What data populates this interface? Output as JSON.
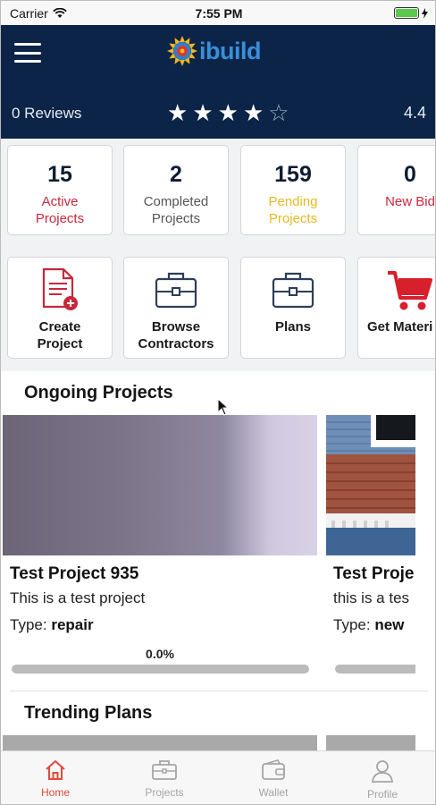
{
  "status_bar": {
    "carrier": "Carrier",
    "time": "7:55 PM"
  },
  "header": {
    "logo_text": "ibuild",
    "reviews": "0 Reviews",
    "stars": [
      "★",
      "★",
      "★",
      "★",
      "☆"
    ],
    "rating_value": 4,
    "rating": "4.4"
  },
  "stats": [
    {
      "value": "15",
      "label_line1": "Active",
      "label_line2": "Projects",
      "color": "#c8283a"
    },
    {
      "value": "2",
      "label_line1": "Completed",
      "label_line2": "Projects",
      "color": "#555555"
    },
    {
      "value": "159",
      "label_line1": "Pending",
      "label_line2": "Projects",
      "color": "#e9b824"
    },
    {
      "value": "0",
      "label_line1": "New Bid",
      "label_line2": "",
      "color": "#c8283a"
    }
  ],
  "actions": [
    {
      "icon": "create-document-icon",
      "label_line1": "Create",
      "label_line2": "Project"
    },
    {
      "icon": "briefcase-icon",
      "label_line1": "Browse",
      "label_line2": "Contractors"
    },
    {
      "icon": "briefcase-icon",
      "label_line1": "Plans",
      "label_line2": ""
    },
    {
      "icon": "cart-icon",
      "label_line1": "Get Materi",
      "label_line2": ""
    }
  ],
  "ongoing": {
    "title": "Ongoing Projects",
    "projects": [
      {
        "title": "Test Project 935",
        "description": "This is a test project",
        "type_label": "Type:",
        "type_value": "repair",
        "progress": "0.0%",
        "progress_value": 0
      },
      {
        "title": "Test Proje",
        "description": "this is a tes",
        "type_label": "Type:",
        "type_value": "new"
      }
    ]
  },
  "trending": {
    "title": "Trending Plans"
  },
  "tabbar": {
    "tabs": [
      {
        "label": "Home",
        "icon": "home-icon",
        "active": true
      },
      {
        "label": "Projects",
        "icon": "projects-icon",
        "active": false
      },
      {
        "label": "Wallet",
        "icon": "wallet-icon",
        "active": false
      },
      {
        "label": "Profile",
        "icon": "profile-icon",
        "active": false
      }
    ]
  },
  "colors": {
    "header_bg": "#0b2447",
    "accent_red": "#c8283a",
    "accent_yellow": "#e9b824",
    "logo_blue": "#3a8fd9",
    "tab_active": "#e24a3a"
  }
}
